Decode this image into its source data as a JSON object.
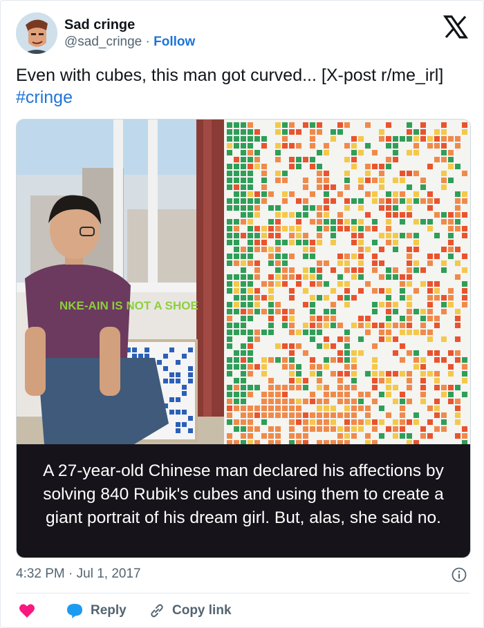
{
  "author": {
    "display_name": "Sad cringe",
    "handle": "@sad_cringe",
    "separator": "·",
    "follow_label": "Follow"
  },
  "post": {
    "text": "Even with cubes, this man got curved... [X-post r/me_irl]",
    "hashtag": "#cringe",
    "image_caption": "A 27-year-old Chinese man declared his affections by solving 840 Rubik's cubes and using them to create a giant portrait of his dream girl. But, alas, she said no.",
    "image_shirt_text": "NKE-AIN IS NOT A SHOE",
    "timestamp": "4:32 PM · Jul 1, 2017"
  },
  "actions": {
    "reply_label": "Reply",
    "copy_link_label": "Copy link"
  },
  "icons": {
    "brand": "x-logo-icon",
    "like": "heart-icon",
    "reply": "speech-bubble-icon",
    "copy": "chain-link-icon",
    "info": "info-icon"
  },
  "colors": {
    "link": "#1d74d8",
    "heart": "#f91880",
    "reply_bubble": "#1d9bf0",
    "secondary_text": "#536471"
  }
}
